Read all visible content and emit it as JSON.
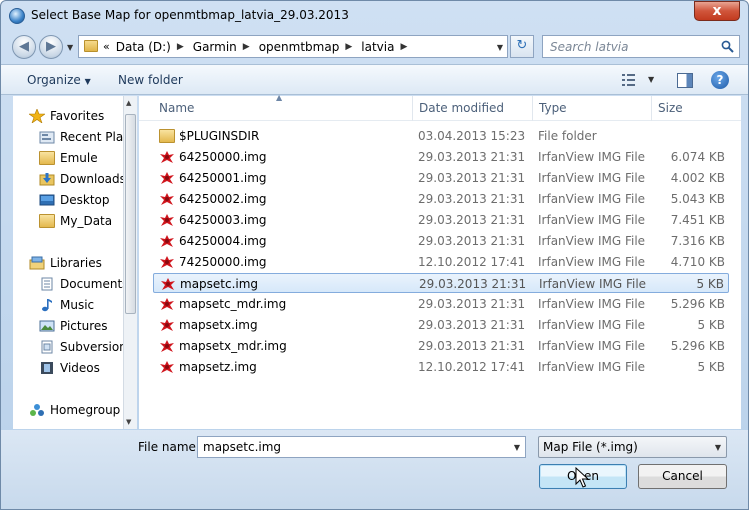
{
  "window": {
    "title": "Select Base Map for openmtbmap_latvia_29.03.2013",
    "close_glyph": "x"
  },
  "navigation": {
    "breadcrumb_prefix": "«",
    "breadcrumbs": [
      "Data (D:)",
      "Garmin",
      "openmtbmap",
      "latvia"
    ],
    "search_placeholder": "Search latvia"
  },
  "toolbar": {
    "organize_label": "Organize",
    "new_folder_label": "New folder",
    "help_glyph": "?"
  },
  "sidebar": {
    "favorites_label": "Favorites",
    "favorites": [
      "Recent Places",
      "Emule",
      "Downloads",
      "Desktop",
      "My_Data"
    ],
    "libraries_label": "Libraries",
    "libraries": [
      "Documents",
      "Music",
      "Pictures",
      "Subversion",
      "Videos"
    ],
    "homegroup_label": "Homegroup"
  },
  "columns": {
    "name": "Name",
    "date_modified": "Date modified",
    "type": "Type",
    "size": "Size"
  },
  "files": [
    {
      "name": "$PLUGINSDIR",
      "date": "03.04.2013 15:23",
      "type": "File folder",
      "size": "",
      "kind": "folder"
    },
    {
      "name": "64250000.img",
      "date": "29.03.2013 21:31",
      "type": "IrfanView IMG File",
      "size": "6.074 KB",
      "kind": "img"
    },
    {
      "name": "64250001.img",
      "date": "29.03.2013 21:31",
      "type": "IrfanView IMG File",
      "size": "4.002 KB",
      "kind": "img"
    },
    {
      "name": "64250002.img",
      "date": "29.03.2013 21:31",
      "type": "IrfanView IMG File",
      "size": "5.043 KB",
      "kind": "img"
    },
    {
      "name": "64250003.img",
      "date": "29.03.2013 21:31",
      "type": "IrfanView IMG File",
      "size": "7.451 KB",
      "kind": "img"
    },
    {
      "name": "64250004.img",
      "date": "29.03.2013 21:31",
      "type": "IrfanView IMG File",
      "size": "7.316 KB",
      "kind": "img"
    },
    {
      "name": "74250000.img",
      "date": "12.10.2012 17:41",
      "type": "IrfanView IMG File",
      "size": "4.710 KB",
      "kind": "img"
    },
    {
      "name": "mapsetc.img",
      "date": "29.03.2013 21:31",
      "type": "IrfanView IMG File",
      "size": "5 KB",
      "kind": "img",
      "selected": true
    },
    {
      "name": "mapsetc_mdr.img",
      "date": "29.03.2013 21:31",
      "type": "IrfanView IMG File",
      "size": "5.296 KB",
      "kind": "img"
    },
    {
      "name": "mapsetx.img",
      "date": "29.03.2013 21:31",
      "type": "IrfanView IMG File",
      "size": "5 KB",
      "kind": "img"
    },
    {
      "name": "mapsetx_mdr.img",
      "date": "29.03.2013 21:31",
      "type": "IrfanView IMG File",
      "size": "5.296 KB",
      "kind": "img"
    },
    {
      "name": "mapsetz.img",
      "date": "12.10.2012 17:41",
      "type": "IrfanView IMG File",
      "size": "5 KB",
      "kind": "img"
    }
  ],
  "footer": {
    "file_name_label": "File name:",
    "file_name_value": "mapsetc.img",
    "filter_value": "Map File (*.img)",
    "open_label": "Open",
    "cancel_label": "Cancel"
  }
}
